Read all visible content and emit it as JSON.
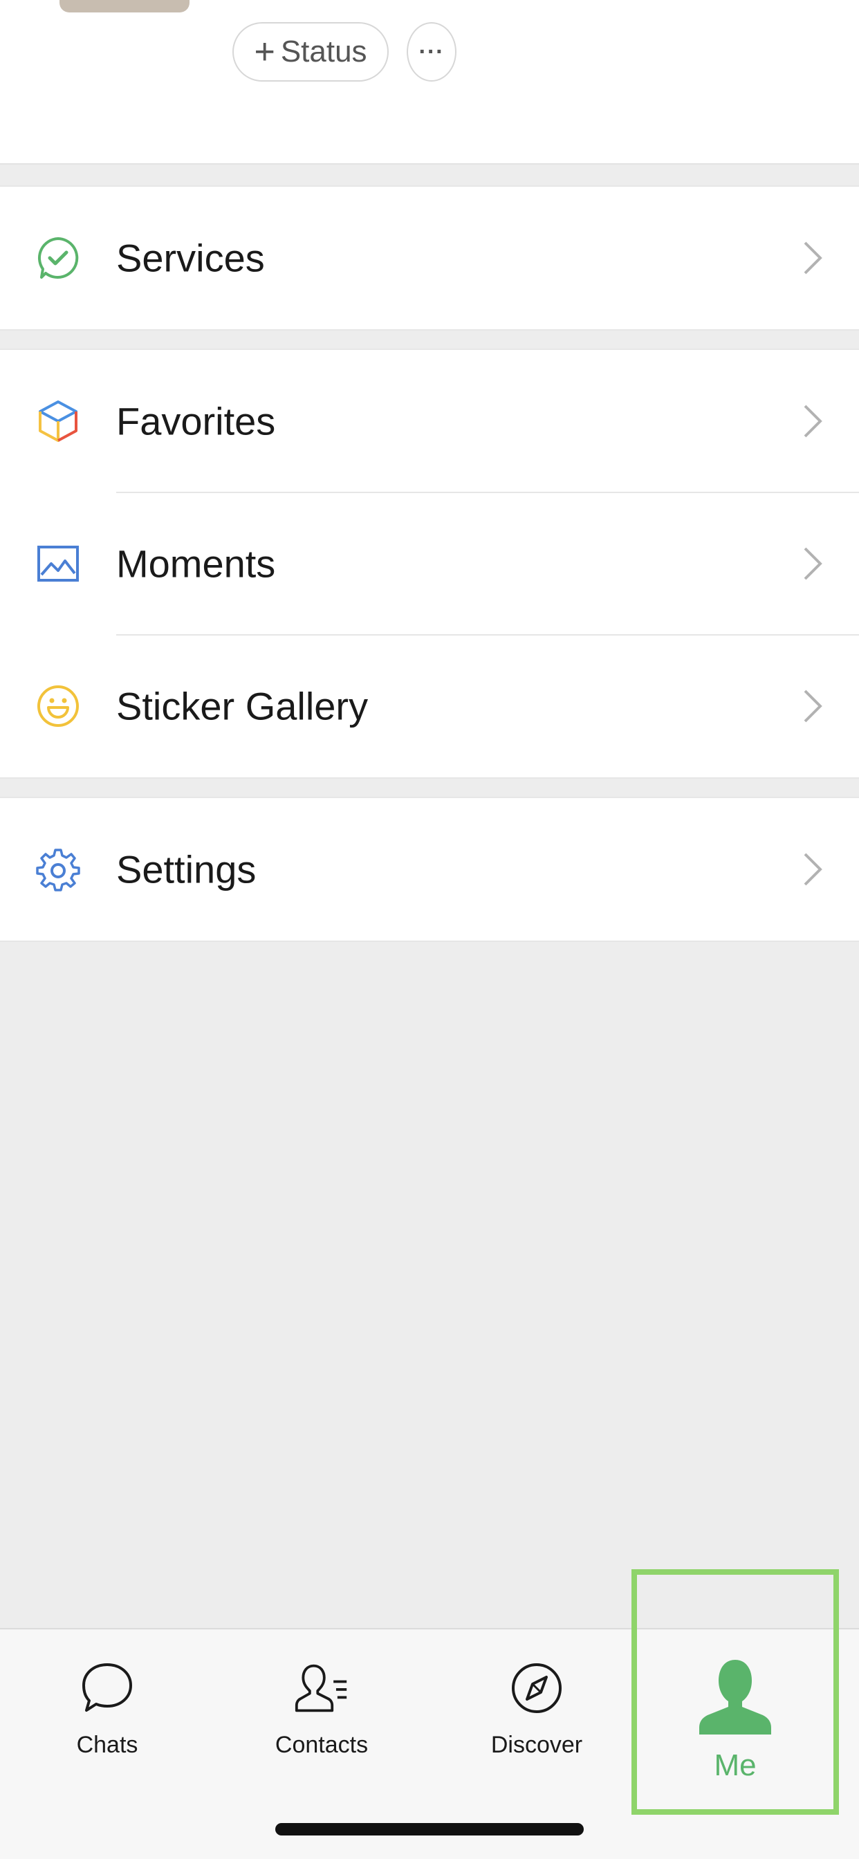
{
  "header": {
    "status_button": {
      "plus": "+",
      "label": "Status"
    },
    "more_button": {
      "label": "···"
    }
  },
  "menu_groups": [
    {
      "items": [
        {
          "label": "Services",
          "icon": "services-icon"
        }
      ]
    },
    {
      "items": [
        {
          "label": "Favorites",
          "icon": "favorites-icon"
        },
        {
          "label": "Moments",
          "icon": "moments-icon"
        },
        {
          "label": "Sticker Gallery",
          "icon": "sticker-gallery-icon"
        }
      ]
    },
    {
      "items": [
        {
          "label": "Settings",
          "icon": "settings-icon"
        }
      ]
    }
  ],
  "tabbar": {
    "tabs": [
      {
        "label": "Chats",
        "icon": "chat-bubble-icon",
        "active": false
      },
      {
        "label": "Contacts",
        "icon": "contacts-icon",
        "active": false
      },
      {
        "label": "Discover",
        "icon": "compass-icon",
        "active": false
      },
      {
        "label": "Me",
        "icon": "person-icon",
        "active": true
      }
    ]
  },
  "colors": {
    "accent_green": "#5ab46b",
    "highlight_border": "#8fd46a",
    "background": "#ededed"
  }
}
